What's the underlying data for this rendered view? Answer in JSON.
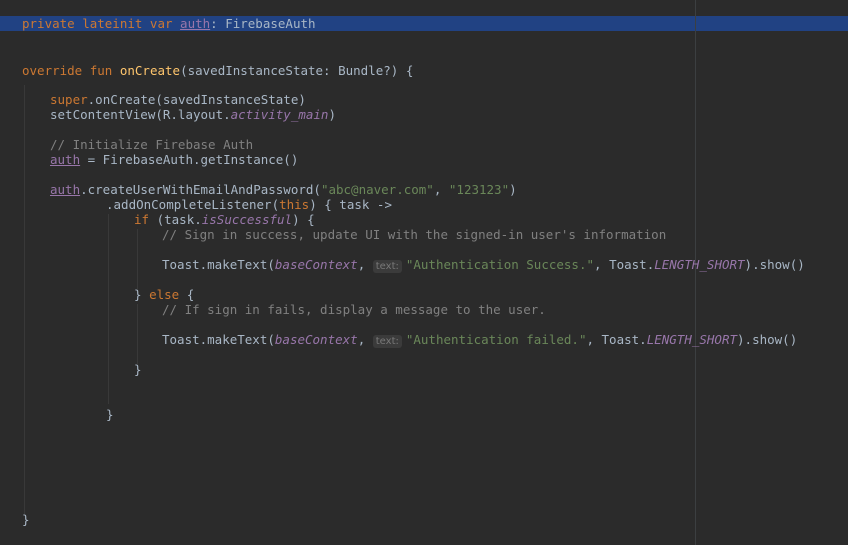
{
  "editor": {
    "lines": {
      "l1": {
        "k1": "private lateinit var ",
        "v": "auth",
        "rest": ": FirebaseAuth"
      },
      "l2": {
        "k1": "override fun ",
        "fn": "onCreate",
        "rest": "(savedInstanceState: Bundle?) {"
      },
      "l3": {
        "k1": "super",
        "rest": ".onCreate(savedInstanceState)"
      },
      "l4": {
        "a": "setContentView(R.layout.",
        "p": "activity_main",
        "b": ")"
      },
      "l5": {
        "c": "// Initialize Firebase Auth"
      },
      "l6": {
        "v": "auth",
        "rest": " = FirebaseAuth.getInstance()"
      },
      "l7": {
        "v": "auth",
        "a": ".createUserWithEmailAndPassword(",
        "s1": "\"abc@naver.com\"",
        "m": ", ",
        "s2": "\"123123\"",
        "b": ")"
      },
      "l8": {
        "a": ".addOnCompleteListener(",
        "k": "this",
        "b": ") { task ->"
      },
      "l9": {
        "k": "if",
        "a": " (task.",
        "p": "isSuccessful",
        "b": ") {"
      },
      "l10": {
        "c": "// Sign in success, update UI with the signed-in user's information"
      },
      "l11": {
        "a": "Toast.makeText(",
        "p": "baseContext",
        "m": ", ",
        "hint": "text:",
        "s": "\"Authentication Success.\"",
        "n": ", Toast.",
        "p2": "LENGTH_SHORT",
        "b": ").show()"
      },
      "l12": {
        "a": "} ",
        "k": "else",
        "b": " {"
      },
      "l13": {
        "c": "// If sign in fails, display a message to the user."
      },
      "l14": {
        "a": "Toast.makeText(",
        "p": "baseContext",
        "m": ", ",
        "hint": "text:",
        "s": "\"Authentication failed.\"",
        "n": ", Toast.",
        "p2": "LENGTH_SHORT",
        "b": ").show()"
      },
      "l15": {
        "a": "}"
      },
      "l16": {
        "a": "}"
      },
      "l17": {
        "a": "}"
      }
    }
  }
}
